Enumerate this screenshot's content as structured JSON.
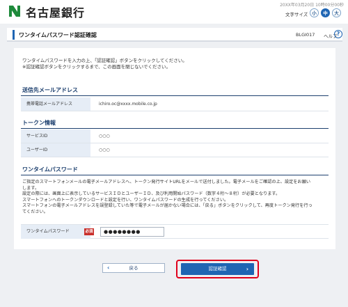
{
  "header": {
    "bank_name": "名古屋銀行",
    "datetime": "20XX年03月20日 10時00分00秒",
    "font_size_label": "文字サイズ",
    "font_size_small": "小",
    "font_size_mid": "中",
    "font_size_large": "大",
    "accent_color": "#1f65b3"
  },
  "title": {
    "page_title": "ワンタイムパスワード認証確認",
    "screen_id": "BLGI017",
    "help_label": "ヘルプ",
    "help_icon": "?"
  },
  "intro": {
    "lines": [
      "ワンタイムパスワードを入力の上、「認証確認」ボタンをクリックしてください。",
      "※認証確認ボタンをクリックするまで、この画面を閉じないでください。"
    ]
  },
  "destination": {
    "heading": "送信先メールアドレス",
    "label": "携帯電話メールアドレス",
    "value": "ichiro.oc@xxxx.mobile.co.jp"
  },
  "token": {
    "heading": "トークン情報",
    "service_label": "サービスID",
    "service_value": "○○○",
    "user_label": "ユーザーID",
    "user_value": "○○○"
  },
  "otp": {
    "heading": "ワンタイムパスワード",
    "desc_lines": [
      "ご指定のスマートフォンメールの電子メールアドレスへ、トークン発行サイトURLをメールで送付しました。電子メールをご確認の上、設定をお願い",
      "します。",
      "設定の際には、画面上に表示しているサービスＩＤとユーザーＩＤ、及び利用開始パスワード（数字４桁～８桁）が必要となります。",
      "スマートフォンへのトークンダウンロードと設定を行い、ワンタイムパスワードの生成を行ってください。",
      "スマートフォンの電子メールアドレスを誤登録していた等で電子メールが届かない場合には、「戻る」ボタンをクリックして、再度トークン発行を行っ",
      "てください。"
    ],
    "field_label": "ワンタイムパスワード",
    "required_badge": "必須",
    "field_value": "●●●●●●●●"
  },
  "buttons": {
    "back_label": "戻る",
    "confirm_label": "認証確認",
    "back_chevron": "‹",
    "confirm_chevron": "›"
  }
}
